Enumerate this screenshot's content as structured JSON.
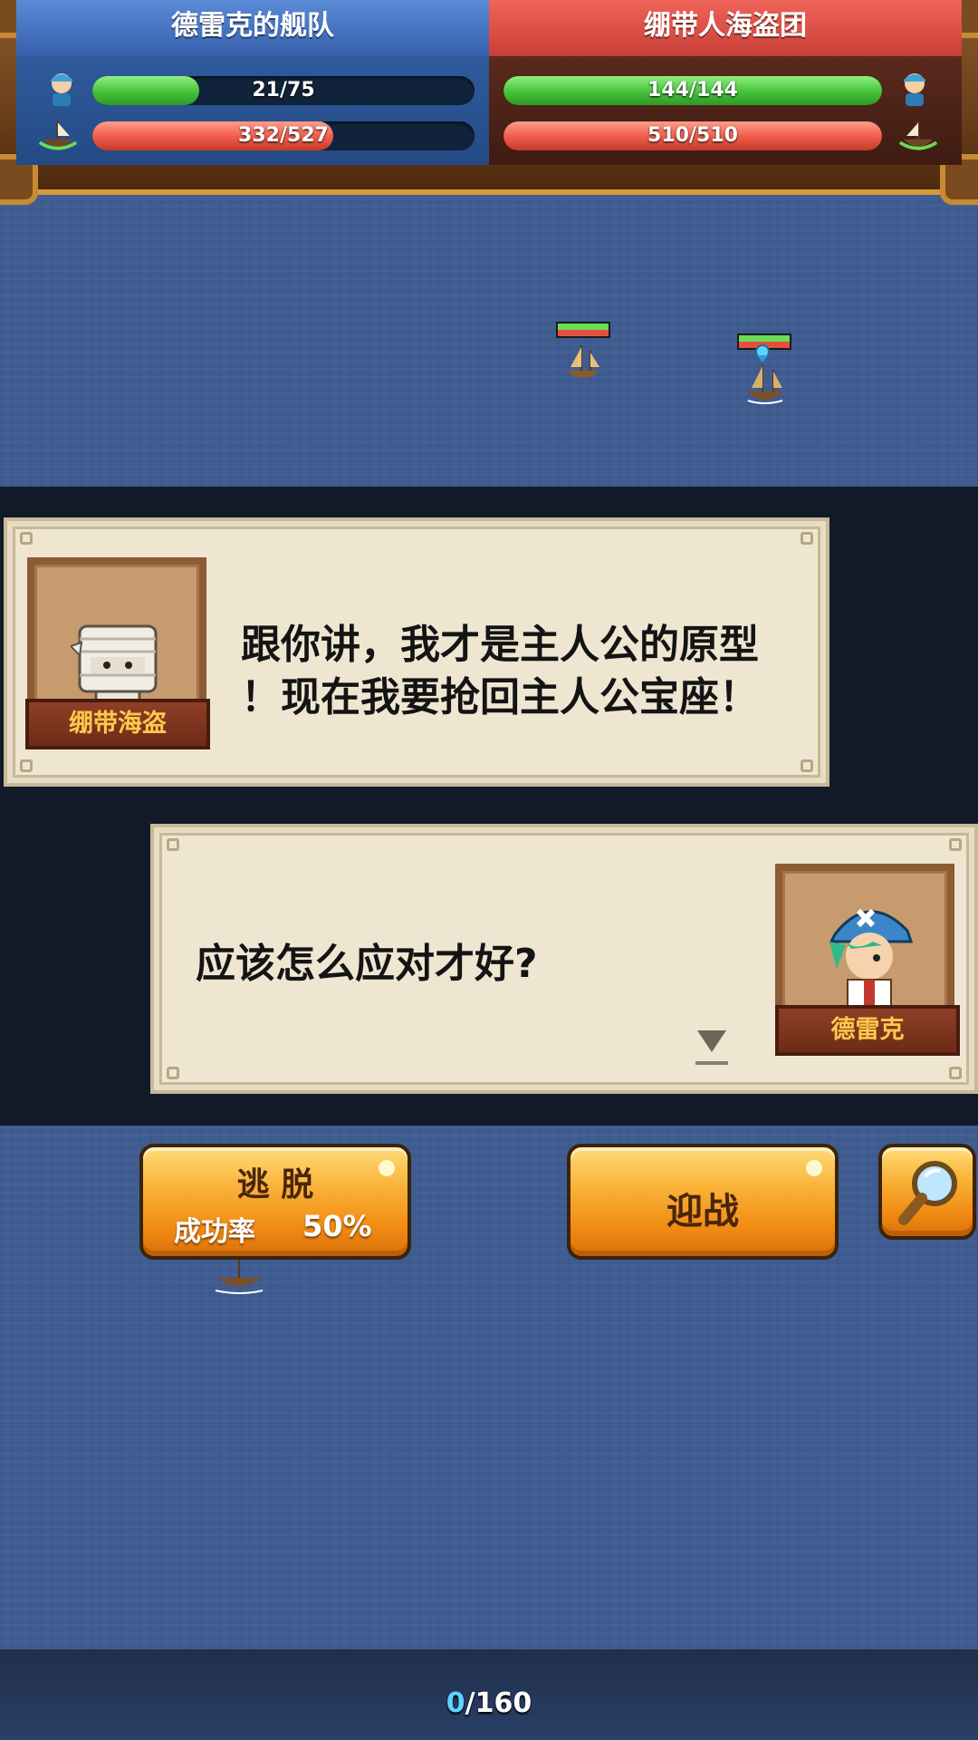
{
  "hud": {
    "left_team": {
      "name": "德雷克的舰队",
      "crew_text": "21/75",
      "crew_fraction": 0.28,
      "ship_hp_text": "332/527",
      "ship_hp_fraction": 0.63
    },
    "right_team": {
      "name": "绷带人海盗团",
      "crew_text": "144/144",
      "crew_fraction": 1.0,
      "ship_hp_text": "510/510",
      "ship_hp_fraction": 1.0
    }
  },
  "dialogs": [
    {
      "speaker": "绷带海盗",
      "text_line1": "跟你讲，我才是主人公的原型",
      "text_line2": "！现在我要抢回主人公宝座！"
    },
    {
      "speaker": "德雷克",
      "text_line1": "应该怎么应对才好?"
    }
  ],
  "buttons": {
    "escape_label": "逃 脱",
    "escape_rate_label": "成功率",
    "escape_rate_value": "50%",
    "fight_label": "迎战"
  },
  "footer": {
    "current": "0",
    "total": "/160"
  },
  "colors": {
    "sea": "#3f5c91",
    "button_orange": "#f9b43a",
    "hp_green": "#46c23a",
    "hp_red": "#ef5b48"
  },
  "icons": [
    "crew-icon",
    "ship-icon",
    "magnifier-icon",
    "next-arrow-icon"
  ]
}
